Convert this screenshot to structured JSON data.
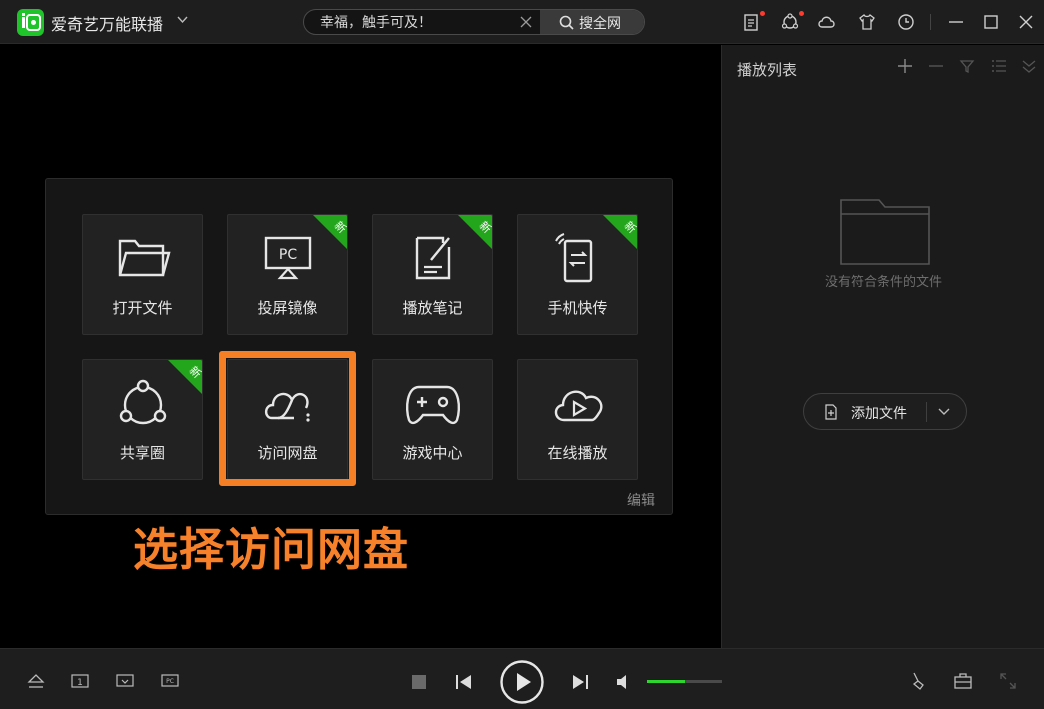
{
  "app": {
    "title": "爱奇艺万能联播"
  },
  "search": {
    "value": "幸福，触手可及！",
    "button_label": "搜全网"
  },
  "playlist": {
    "title": "播放列表",
    "empty_text": "没有符合条件的文件",
    "add_file_label": "添加文件"
  },
  "panel": {
    "tiles": [
      {
        "label": "打开文件",
        "icon": "folder-icon",
        "new": false
      },
      {
        "label": "投屏镜像",
        "icon": "pc-cast-icon",
        "new": true,
        "badge": "新"
      },
      {
        "label": "播放笔记",
        "icon": "note-icon",
        "new": true,
        "badge": "新"
      },
      {
        "label": "手机快传",
        "icon": "phone-transfer-icon",
        "new": true,
        "badge": "新"
      },
      {
        "label": "共享圈",
        "icon": "share-circle-icon",
        "new": true,
        "badge": "新"
      },
      {
        "label": "访问网盘",
        "icon": "cloud-drive-icon",
        "new": false,
        "highlighted": true
      },
      {
        "label": "游戏中心",
        "icon": "gamepad-icon",
        "new": false
      },
      {
        "label": "在线播放",
        "icon": "cloud-play-icon",
        "new": false
      }
    ],
    "edit_label": "编辑"
  },
  "annotation": {
    "text": "选择访问网盘"
  },
  "player": {
    "volume": 0.5
  },
  "colors": {
    "accent": "#1fc32a",
    "highlight": "#f57f24",
    "badge": "#23a51c",
    "volume": "#2fd52f"
  }
}
